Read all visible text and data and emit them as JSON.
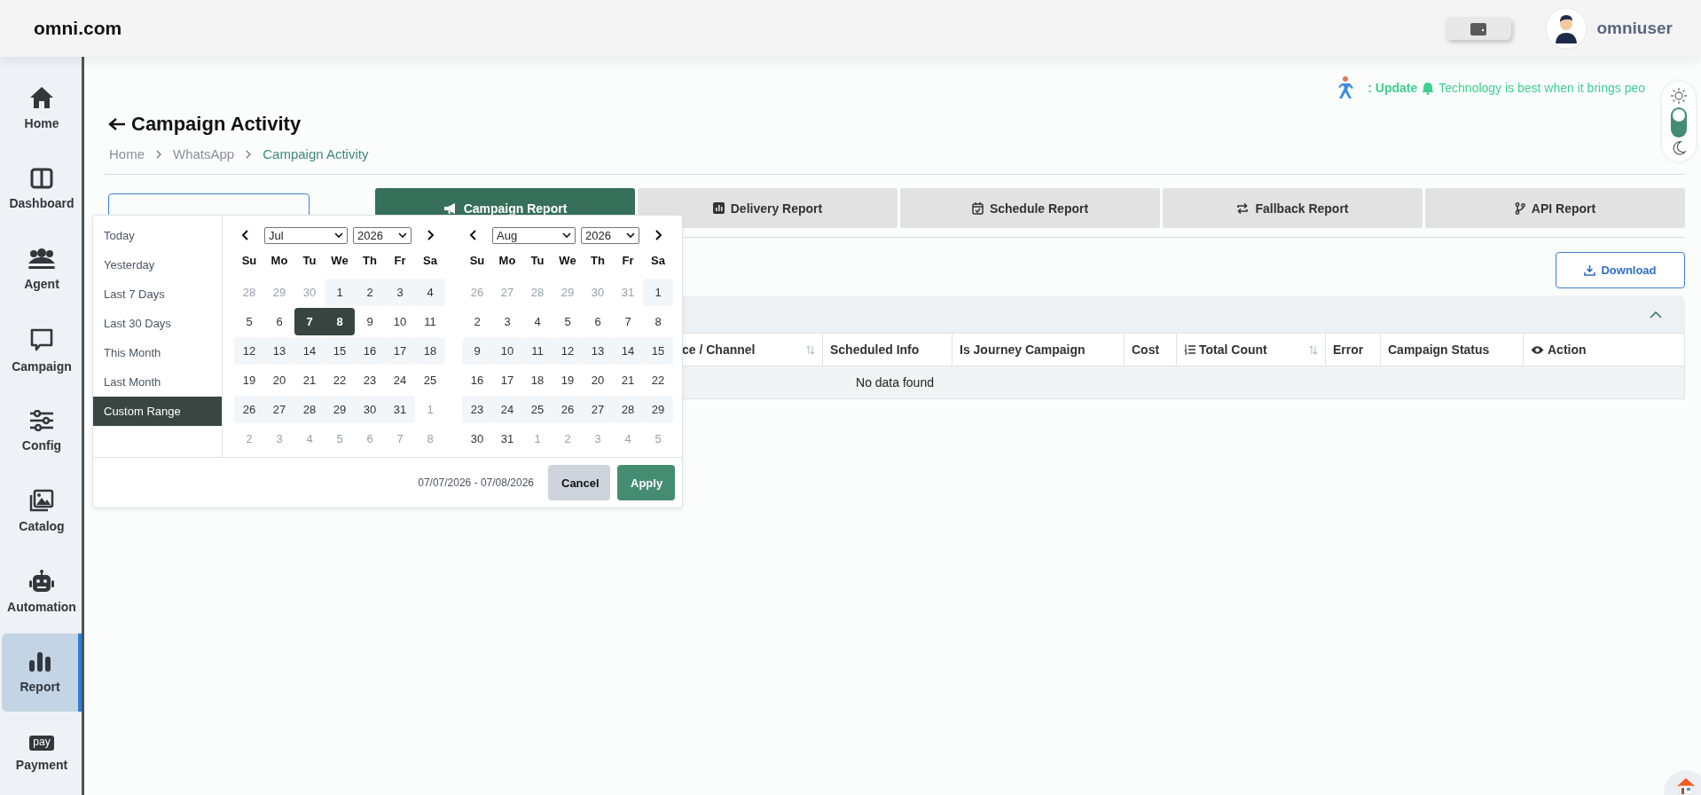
{
  "header": {
    "logo": "omni.com",
    "username": "omniuser"
  },
  "sidebar": {
    "items": [
      {
        "label": "Home",
        "selected": false
      },
      {
        "label": "Dashboard",
        "selected": false
      },
      {
        "label": "Agent",
        "selected": false
      },
      {
        "label": "Campaign",
        "selected": false
      },
      {
        "label": "Config",
        "selected": false
      },
      {
        "label": "Catalog",
        "selected": false
      },
      {
        "label": "Automation",
        "selected": false
      },
      {
        "label": "Report",
        "selected": true
      },
      {
        "label": "Payment",
        "selected": false,
        "icon_text": "pay"
      }
    ]
  },
  "ticker": {
    "label": ": Update",
    "message": "Technology is best when it brings peo"
  },
  "theme_toggle": {
    "dark": false
  },
  "page": {
    "title": "Campaign Activity",
    "breadcrumb": [
      {
        "label": "Home",
        "current": false
      },
      {
        "label": "WhatsApp",
        "current": false
      },
      {
        "label": "Campaign Activity",
        "current": true
      }
    ]
  },
  "tabs": [
    {
      "label": "Campaign Report",
      "selected": true
    },
    {
      "label": "Delivery Report",
      "selected": false
    },
    {
      "label": "Schedule Report",
      "selected": false
    },
    {
      "label": "Fallback Report",
      "selected": false
    },
    {
      "label": "API Report",
      "selected": false
    }
  ],
  "download_button": "Download",
  "table": {
    "columns": [
      {
        "label": "ce / Channel",
        "sortable": true
      },
      {
        "label": "Scheduled Info",
        "sortable": false
      },
      {
        "label": "Is Journey Campaign",
        "sortable": false
      },
      {
        "label": "Cost",
        "sortable": false
      },
      {
        "label": "Total Count",
        "sortable": true
      },
      {
        "label": "Error",
        "sortable": false
      },
      {
        "label": "Campaign Status",
        "sortable": false
      },
      {
        "label": "Action",
        "sortable": false
      }
    ],
    "empty_message": "No data found"
  },
  "date_picker": {
    "ranges": [
      {
        "label": "Today",
        "selected": false
      },
      {
        "label": "Yesterday",
        "selected": false
      },
      {
        "label": "Last 7 Days",
        "selected": false
      },
      {
        "label": "Last 30 Days",
        "selected": false
      },
      {
        "label": "This Month",
        "selected": false
      },
      {
        "label": "Last Month",
        "selected": false
      },
      {
        "label": "Custom Range",
        "selected": true
      }
    ],
    "calendars": [
      {
        "month": "Jul",
        "year": "2026",
        "weekdays": [
          "Su",
          "Mo",
          "Tu",
          "We",
          "Th",
          "Fr",
          "Sa"
        ],
        "weeks": [
          [
            {
              "d": "28",
              "off": true,
              "selected": false
            },
            {
              "d": "29",
              "off": true,
              "selected": false
            },
            {
              "d": "30",
              "off": true,
              "selected": false
            },
            {
              "d": "1",
              "off": false,
              "selected": false
            },
            {
              "d": "2",
              "off": false,
              "selected": false
            },
            {
              "d": "3",
              "off": false,
              "selected": false
            },
            {
              "d": "4",
              "off": false,
              "selected": false
            }
          ],
          [
            {
              "d": "5",
              "off": false,
              "selected": false
            },
            {
              "d": "6",
              "off": false,
              "selected": false
            },
            {
              "d": "7",
              "off": false,
              "selected": true
            },
            {
              "d": "8",
              "off": false,
              "selected": true
            },
            {
              "d": "9",
              "off": false,
              "selected": false
            },
            {
              "d": "10",
              "off": false,
              "selected": false
            },
            {
              "d": "11",
              "off": false,
              "selected": false
            }
          ],
          [
            {
              "d": "12",
              "off": false,
              "selected": false
            },
            {
              "d": "13",
              "off": false,
              "selected": false
            },
            {
              "d": "14",
              "off": false,
              "selected": false
            },
            {
              "d": "15",
              "off": false,
              "selected": false
            },
            {
              "d": "16",
              "off": false,
              "selected": false
            },
            {
              "d": "17",
              "off": false,
              "selected": false
            },
            {
              "d": "18",
              "off": false,
              "selected": false
            }
          ],
          [
            {
              "d": "19",
              "off": false,
              "selected": false
            },
            {
              "d": "20",
              "off": false,
              "selected": false
            },
            {
              "d": "21",
              "off": false,
              "selected": false
            },
            {
              "d": "22",
              "off": false,
              "selected": false
            },
            {
              "d": "23",
              "off": false,
              "selected": false
            },
            {
              "d": "24",
              "off": false,
              "selected": false
            },
            {
              "d": "25",
              "off": false,
              "selected": false
            }
          ],
          [
            {
              "d": "26",
              "off": false,
              "selected": false
            },
            {
              "d": "27",
              "off": false,
              "selected": false
            },
            {
              "d": "28",
              "off": false,
              "selected": false
            },
            {
              "d": "29",
              "off": false,
              "selected": false
            },
            {
              "d": "30",
              "off": false,
              "selected": false
            },
            {
              "d": "31",
              "off": false,
              "selected": false
            },
            {
              "d": "1",
              "off": true,
              "selected": false
            }
          ],
          [
            {
              "d": "2",
              "off": true,
              "selected": false
            },
            {
              "d": "3",
              "off": true,
              "selected": false
            },
            {
              "d": "4",
              "off": true,
              "selected": false
            },
            {
              "d": "5",
              "off": true,
              "selected": false
            },
            {
              "d": "6",
              "off": true,
              "selected": false
            },
            {
              "d": "7",
              "off": true,
              "selected": false
            },
            {
              "d": "8",
              "off": true,
              "selected": false
            }
          ]
        ]
      },
      {
        "month": "Aug",
        "year": "2026",
        "weekdays": [
          "Su",
          "Mo",
          "Tu",
          "We",
          "Th",
          "Fr",
          "Sa"
        ],
        "weeks": [
          [
            {
              "d": "26",
              "off": true,
              "selected": false
            },
            {
              "d": "27",
              "off": true,
              "selected": false
            },
            {
              "d": "28",
              "off": true,
              "selected": false
            },
            {
              "d": "29",
              "off": true,
              "selected": false
            },
            {
              "d": "30",
              "off": true,
              "selected": false
            },
            {
              "d": "31",
              "off": true,
              "selected": false
            },
            {
              "d": "1",
              "off": false,
              "selected": false
            }
          ],
          [
            {
              "d": "2",
              "off": false,
              "selected": false
            },
            {
              "d": "3",
              "off": false,
              "selected": false
            },
            {
              "d": "4",
              "off": false,
              "selected": false
            },
            {
              "d": "5",
              "off": false,
              "selected": false
            },
            {
              "d": "6",
              "off": false,
              "selected": false
            },
            {
              "d": "7",
              "off": false,
              "selected": false
            },
            {
              "d": "8",
              "off": false,
              "selected": false
            }
          ],
          [
            {
              "d": "9",
              "off": false,
              "selected": false
            },
            {
              "d": "10",
              "off": false,
              "selected": false
            },
            {
              "d": "11",
              "off": false,
              "selected": false
            },
            {
              "d": "12",
              "off": false,
              "selected": false
            },
            {
              "d": "13",
              "off": false,
              "selected": false
            },
            {
              "d": "14",
              "off": false,
              "selected": false
            },
            {
              "d": "15",
              "off": false,
              "selected": false
            }
          ],
          [
            {
              "d": "16",
              "off": false,
              "selected": false
            },
            {
              "d": "17",
              "off": false,
              "selected": false
            },
            {
              "d": "18",
              "off": false,
              "selected": false
            },
            {
              "d": "19",
              "off": false,
              "selected": false
            },
            {
              "d": "20",
              "off": false,
              "selected": false
            },
            {
              "d": "21",
              "off": false,
              "selected": false
            },
            {
              "d": "22",
              "off": false,
              "selected": false
            }
          ],
          [
            {
              "d": "23",
              "off": false,
              "selected": false
            },
            {
              "d": "24",
              "off": false,
              "selected": false
            },
            {
              "d": "25",
              "off": false,
              "selected": false
            },
            {
              "d": "26",
              "off": false,
              "selected": false
            },
            {
              "d": "27",
              "off": false,
              "selected": false
            },
            {
              "d": "28",
              "off": false,
              "selected": false
            },
            {
              "d": "29",
              "off": false,
              "selected": false
            }
          ],
          [
            {
              "d": "30",
              "off": false,
              "selected": false
            },
            {
              "d": "31",
              "off": false,
              "selected": false
            },
            {
              "d": "1",
              "off": true,
              "selected": false
            },
            {
              "d": "2",
              "off": true,
              "selected": false
            },
            {
              "d": "3",
              "off": true,
              "selected": false
            },
            {
              "d": "4",
              "off": true,
              "selected": false
            },
            {
              "d": "5",
              "off": true,
              "selected": false
            }
          ]
        ]
      }
    ],
    "range_text": "07/07/2026 - 07/08/2026",
    "buttons": [
      {
        "label": "Cancel",
        "kind": "cancel"
      },
      {
        "label": "Apply",
        "kind": "apply"
      }
    ]
  }
}
